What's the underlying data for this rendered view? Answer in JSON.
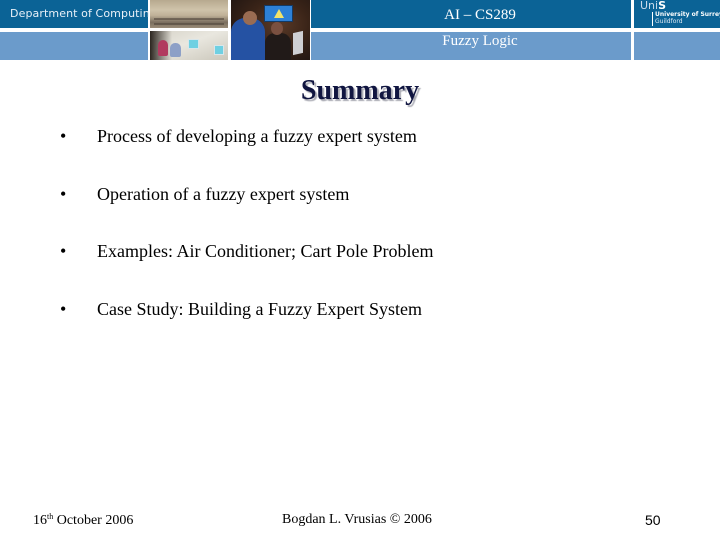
{
  "header": {
    "department": "Department of Computing",
    "course_code": "AI – CS289",
    "course_subtitle": "Fuzzy Logic",
    "logo": {
      "uni_prefix": "Uni",
      "uni_suffix": "S",
      "university": "University of Surrey",
      "location": "Guildford"
    },
    "colors": {
      "dark_blue": "#0b6396",
      "light_blue": "#6b9bcb"
    }
  },
  "slide": {
    "title": "Summary",
    "bullets": [
      "Process of developing a fuzzy expert system",
      "Operation of a fuzzy expert system",
      "Examples: Air Conditioner; Cart Pole Problem",
      "Case Study: Building a Fuzzy Expert System"
    ],
    "bullet_glyph": "•"
  },
  "footer": {
    "date_day": "16",
    "date_suffix": "th",
    "date_rest": " October 2006",
    "author": "Bogdan L. Vrusias © 2006",
    "page_number": "50"
  }
}
